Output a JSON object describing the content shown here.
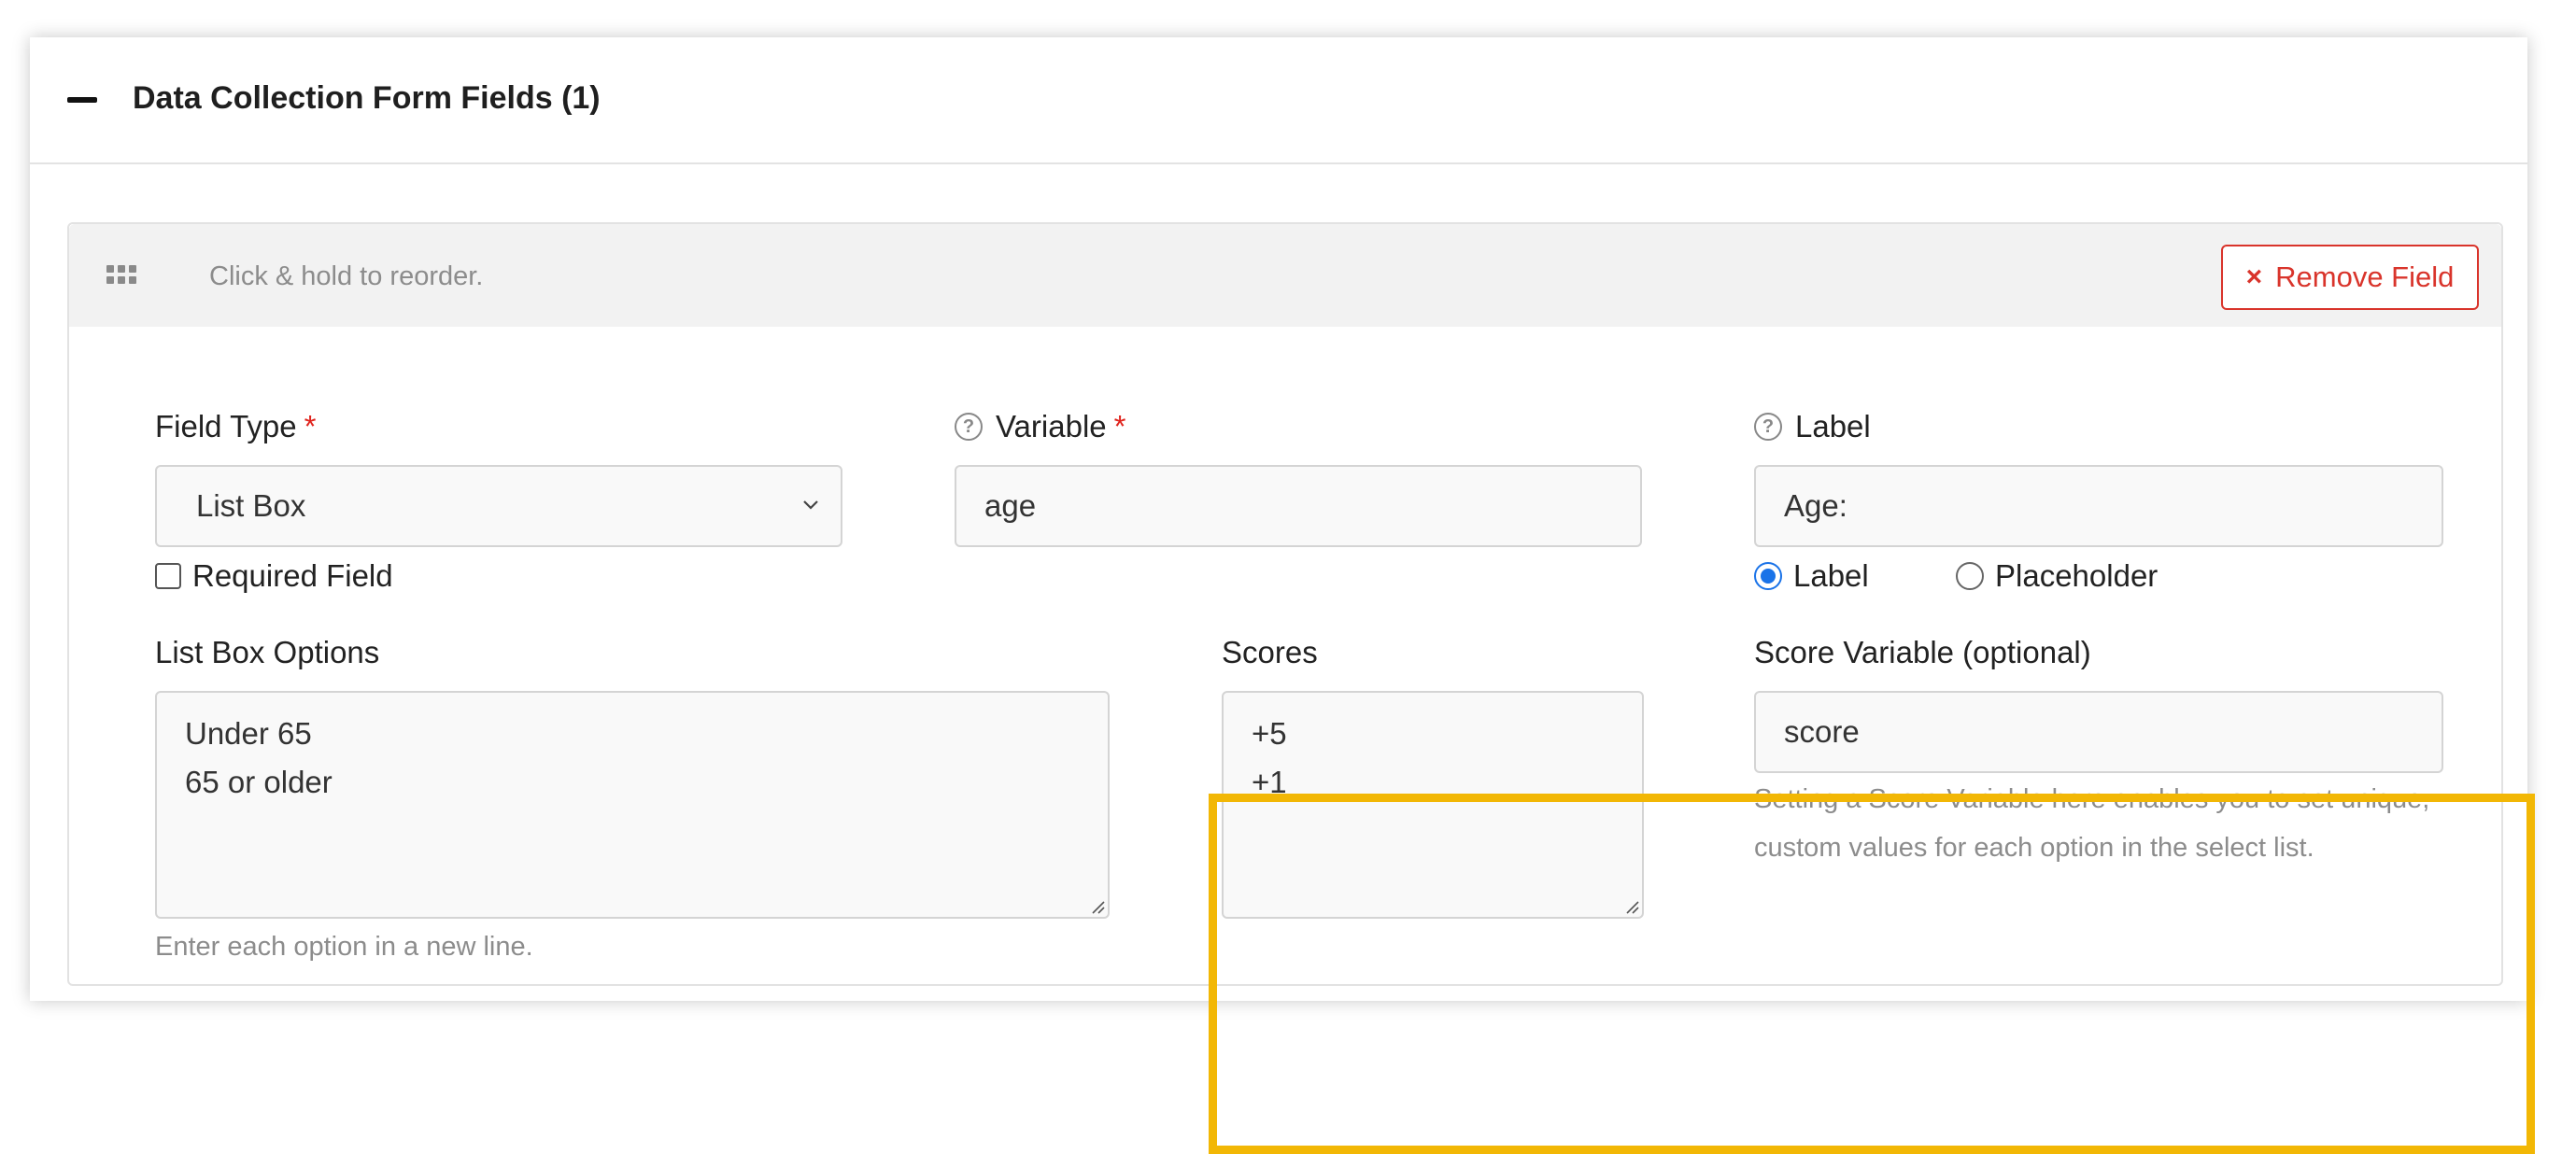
{
  "panel": {
    "title": "Data Collection Form Fields (1)",
    "collapse_icon": "minus-icon"
  },
  "card": {
    "drag_icon": "drag-handle-icon",
    "reorder_hint": "Click & hold to reorder.",
    "remove_label": "Remove Field",
    "remove_icon": "×",
    "accent_color": "#d9342b"
  },
  "field_type": {
    "label": "Field Type",
    "required_mark": "*",
    "value": "List Box"
  },
  "required_field": {
    "label": "Required Field",
    "checked": false
  },
  "variable": {
    "label": "Variable",
    "required_mark": "*",
    "help_icon": "?",
    "value": "age"
  },
  "label_field": {
    "label": "Label",
    "help_icon": "?",
    "value": "Age:",
    "display_options": [
      {
        "label": "Label",
        "selected": true
      },
      {
        "label": "Placeholder",
        "selected": false
      }
    ]
  },
  "list_box_options": {
    "label": "List Box Options",
    "lines": [
      "Under 65",
      "65 or older"
    ],
    "hint": "Enter each option in a new line."
  },
  "scores": {
    "label": "Scores",
    "lines": [
      "+5",
      "+1"
    ]
  },
  "score_variable": {
    "label": "Score Variable (optional)",
    "value": "score",
    "hint_line1": "Setting a Score Variable here enables you to set unique,",
    "hint_line2": "custom values for each option in the select list."
  },
  "highlight_color": "#f2b705"
}
